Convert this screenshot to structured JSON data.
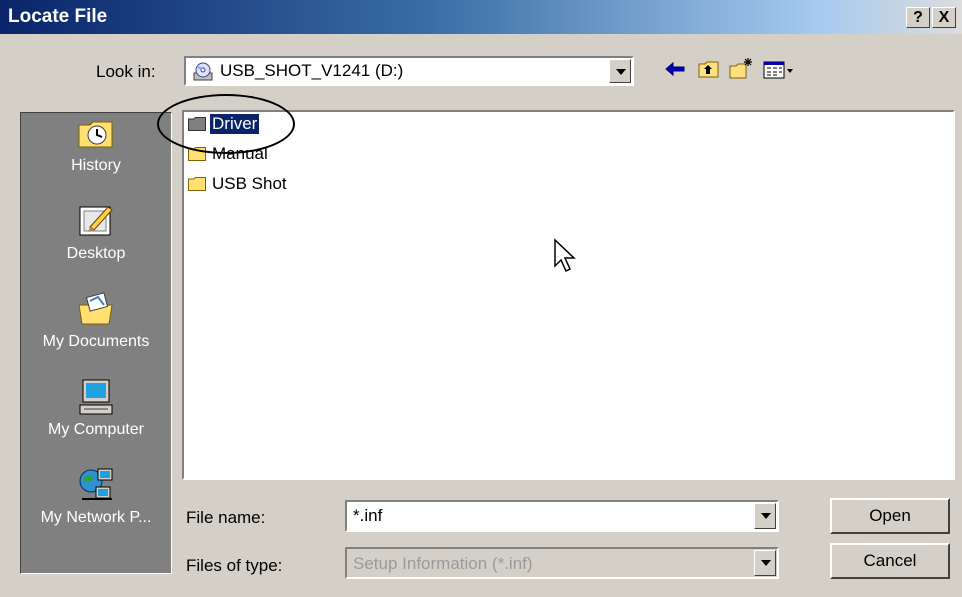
{
  "window": {
    "title": "Locate File",
    "help_label": "?",
    "close_label": "X"
  },
  "lookin": {
    "label": "Look in:",
    "value": "USB_SHOT_V1241 (D:)"
  },
  "toolbar": {
    "icons": [
      "back-icon",
      "up-one-level-icon",
      "new-folder-icon",
      "view-menu-icon"
    ]
  },
  "places": [
    {
      "label": "History",
      "icon": "history-icon"
    },
    {
      "label": "Desktop",
      "icon": "desktop-icon"
    },
    {
      "label": "My Documents",
      "icon": "my-documents-icon"
    },
    {
      "label": "My Computer",
      "icon": "my-computer-icon"
    },
    {
      "label": "My Network P...",
      "icon": "my-network-places-icon"
    }
  ],
  "files": [
    {
      "name": "Driver",
      "selected": true
    },
    {
      "name": "Manual",
      "selected": false
    },
    {
      "name": "USB Shot",
      "selected": false
    }
  ],
  "filename": {
    "label": "File name:",
    "value": "*.inf"
  },
  "filetype": {
    "label": "Files of type:",
    "value": "Setup Information (*.inf)"
  },
  "buttons": {
    "open": "Open",
    "cancel": "Cancel"
  },
  "colors": {
    "title_start": "#0a246a",
    "selection": "#0a246a",
    "face": "#d4d0c8",
    "places_bg": "#808080"
  }
}
